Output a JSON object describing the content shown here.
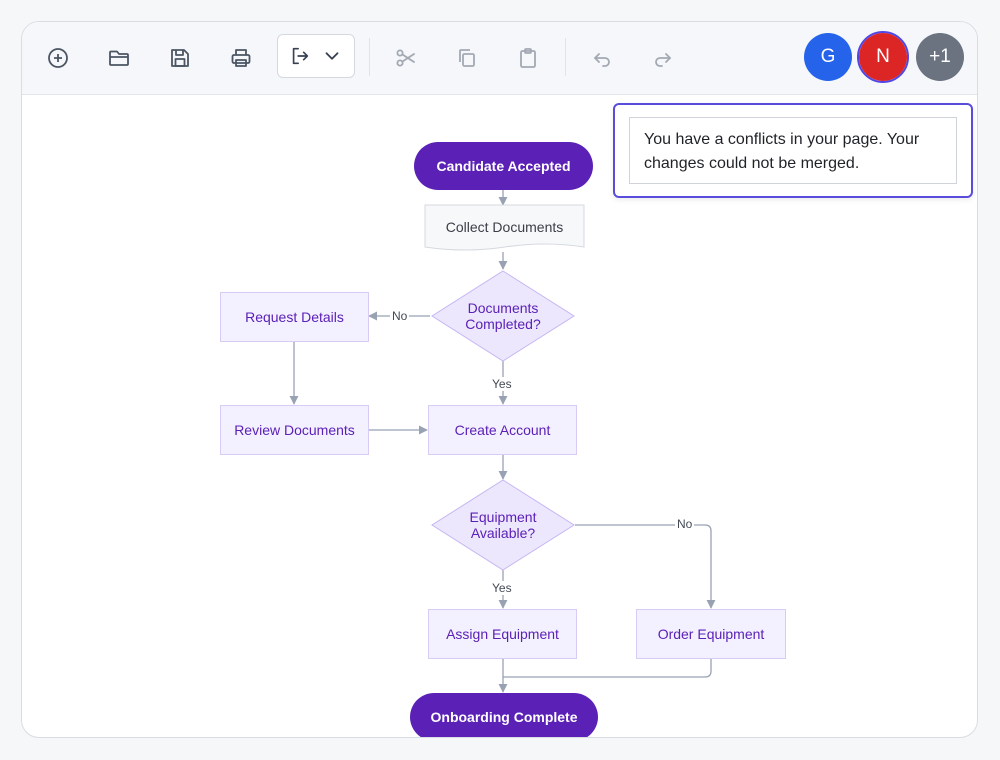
{
  "toolbar": {
    "buttons": [
      {
        "name": "new-icon",
        "enabled": true
      },
      {
        "name": "open-folder-icon",
        "enabled": true
      },
      {
        "name": "save-icon",
        "enabled": true
      },
      {
        "name": "print-icon",
        "enabled": true
      },
      {
        "name": "export-icon",
        "enabled": true
      },
      {
        "name": "cut-icon",
        "enabled": false
      },
      {
        "name": "copy-icon",
        "enabled": false
      },
      {
        "name": "paste-icon",
        "enabled": false
      },
      {
        "name": "undo-icon",
        "enabled": false
      },
      {
        "name": "redo-icon",
        "enabled": false
      }
    ]
  },
  "collaborators": {
    "users": [
      {
        "initial": "G",
        "color": "#2563eb"
      },
      {
        "initial": "N",
        "color": "#dc2626",
        "ring": "#4f46e5"
      }
    ],
    "overflow_label": "+1",
    "overflow_color": "#6b7280"
  },
  "notification": {
    "message": "You have a conflicts in your page. Your changes could not be merged."
  },
  "diagram": {
    "nodes": {
      "start": "Candidate Accepted",
      "collect": "Collect Documents",
      "docs_decision": "Documents Completed?",
      "request": "Request Details",
      "review": "Review Documents",
      "create": "Create Account",
      "equip_decision": "Equipment Available?",
      "assign": "Assign Equipment",
      "order": "Order Equipment",
      "end": "Onboarding Complete"
    },
    "edge_labels": {
      "docs_no": "No",
      "docs_yes": "Yes",
      "equip_no": "No",
      "equip_yes": "Yes"
    },
    "colors": {
      "terminal": "#5b21b6",
      "process_fill": "#f3f0ff",
      "process_border": "#d8ccf5",
      "connector": "#98a2b3"
    }
  }
}
